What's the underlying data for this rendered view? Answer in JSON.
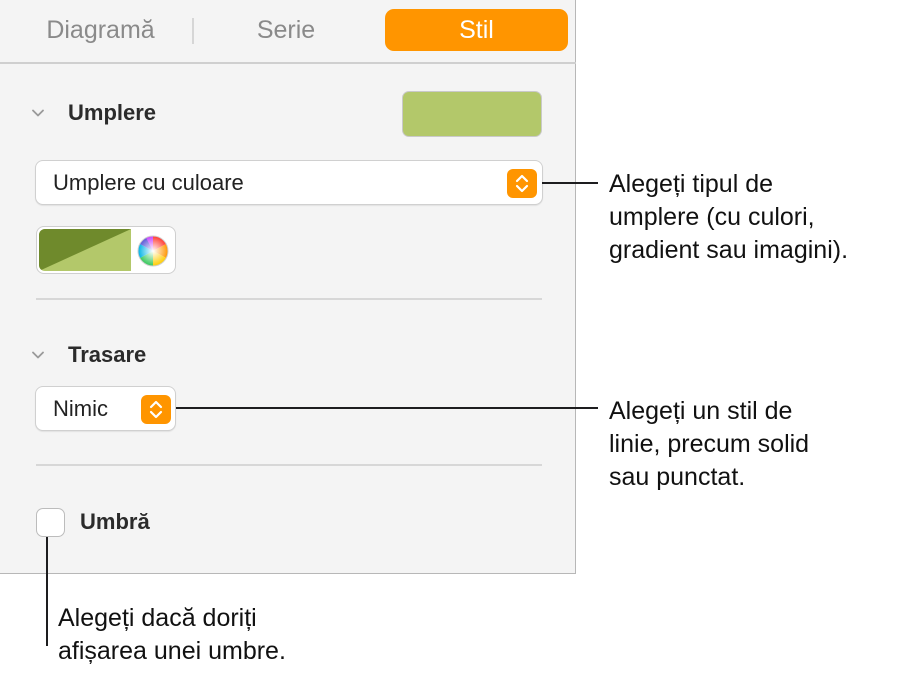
{
  "tabs": [
    {
      "label": "Diagramă",
      "active": false
    },
    {
      "label": "Serie",
      "active": false
    },
    {
      "label": "Stil",
      "active": true
    }
  ],
  "accent_color": "#ff9500",
  "fill_section": {
    "title": "Umplere",
    "swatch_color": "#b3c86a",
    "fill_type": "Umplere cu culoare",
    "well_colors": [
      "#6f8a2c",
      "#b3c86a"
    ]
  },
  "stroke_section": {
    "title": "Trasare",
    "style": "Nimic"
  },
  "shadow": {
    "label": "Umbră",
    "checked": false
  },
  "callouts": {
    "fill_type": [
      "Alegeți tipul de",
      "umplere (cu culori,",
      "gradient sau imagini)."
    ],
    "stroke_style": [
      "Alegeți un stil de",
      "linie, precum solid",
      "sau punctat."
    ],
    "shadow": [
      "Alegeți dacă doriți",
      "afișarea unei umbre."
    ]
  }
}
